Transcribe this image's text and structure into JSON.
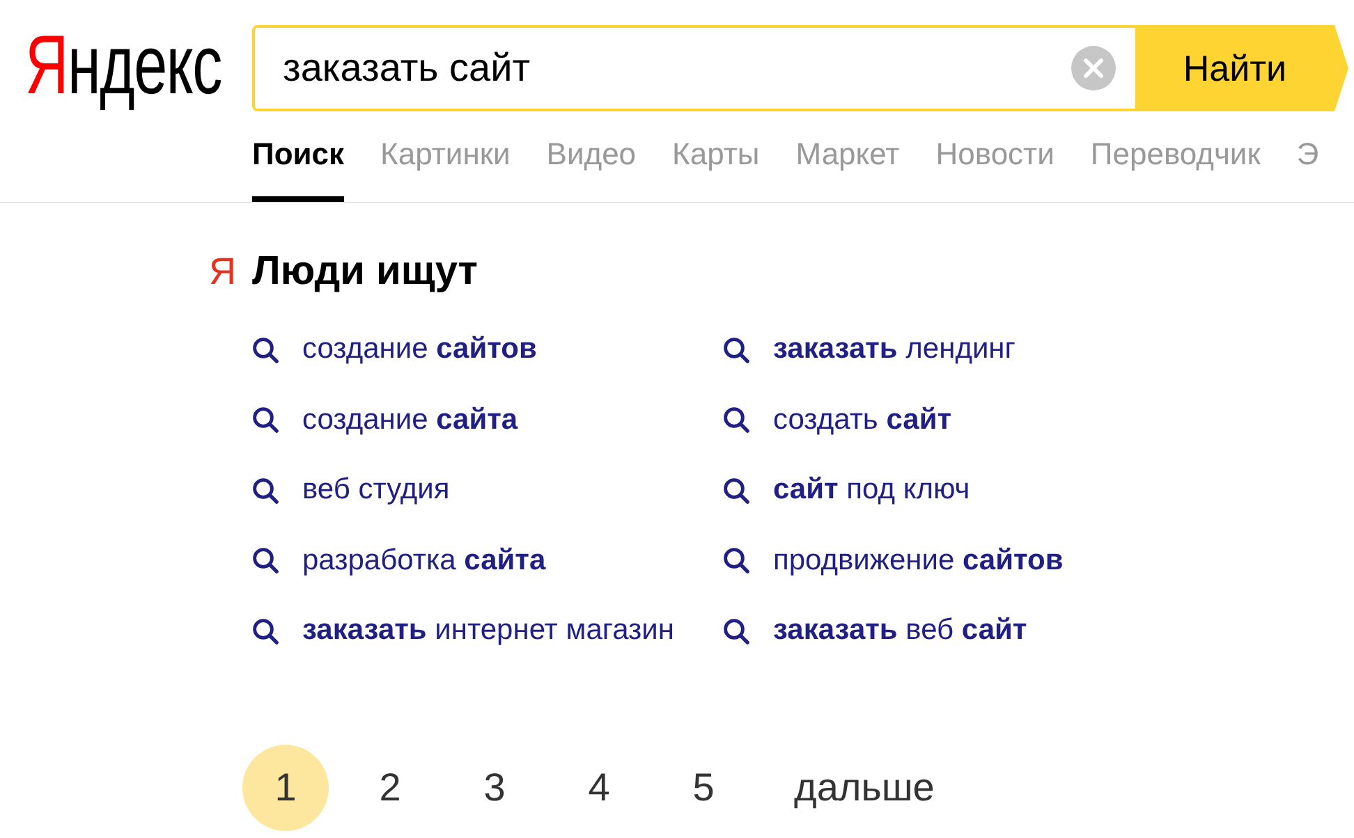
{
  "logo": {
    "accent": "Я",
    "text": "ндекс"
  },
  "search": {
    "value": "заказать сайт",
    "button": "Найти"
  },
  "tabs": [
    {
      "label": "Поиск",
      "selected": true
    },
    {
      "label": "Картинки",
      "selected": false
    },
    {
      "label": "Видео",
      "selected": false
    },
    {
      "label": "Карты",
      "selected": false
    },
    {
      "label": "Маркет",
      "selected": false
    },
    {
      "label": "Новости",
      "selected": false
    },
    {
      "label": "Переводчик",
      "selected": false
    },
    {
      "label": "Э",
      "selected": false
    }
  ],
  "related": {
    "mark": "Я",
    "title": "Люди ищут",
    "items": [
      "создание **сайтов**",
      "создание **сайта**",
      "веб студия",
      "разработка **сайта**",
      "**заказать** интернет магазин",
      "**заказать** лендинг",
      "создать **сайт**",
      "**сайт** под ключ",
      "продвижение **сайтов**",
      "**заказать** веб **сайт**"
    ]
  },
  "pagination": {
    "pages": [
      {
        "label": "1",
        "selected": true
      },
      {
        "label": "2",
        "selected": false
      },
      {
        "label": "3",
        "selected": false
      },
      {
        "label": "4",
        "selected": false
      },
      {
        "label": "5",
        "selected": false
      }
    ],
    "next": "дальше"
  }
}
